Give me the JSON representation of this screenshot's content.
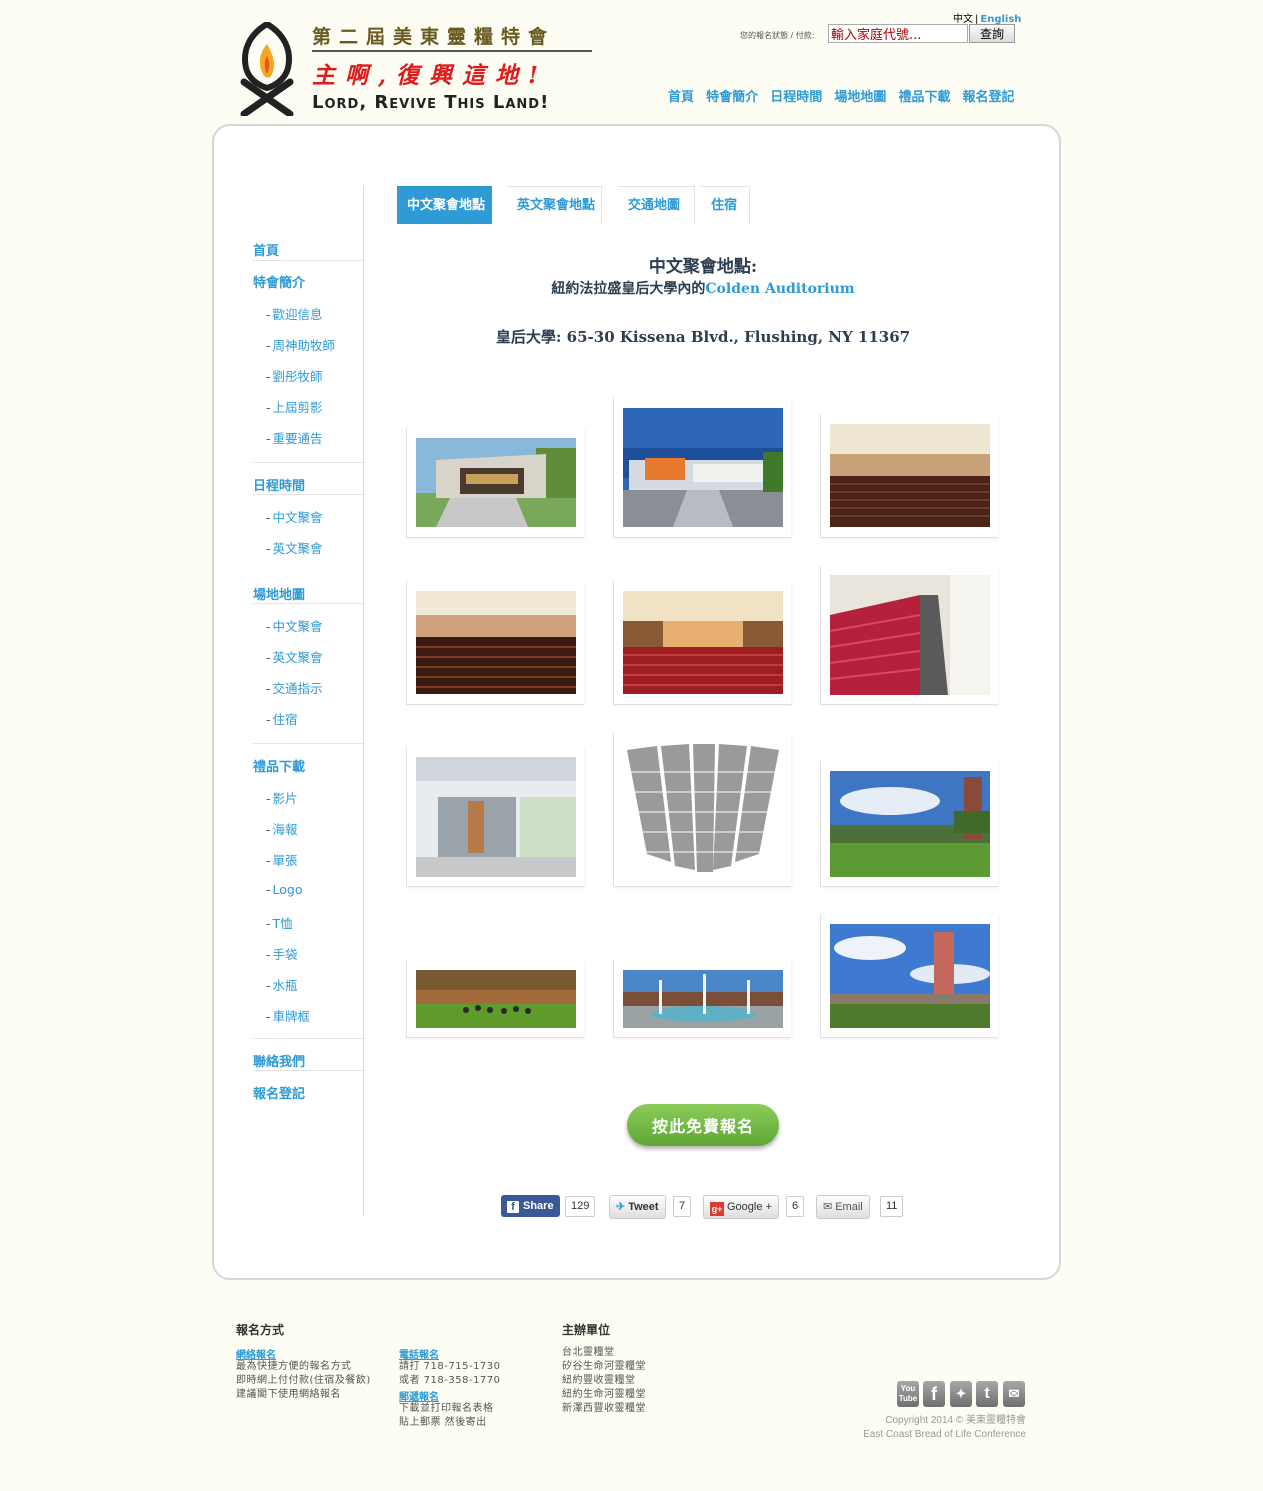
{
  "header": {
    "title_cn": "第二屆美東靈糧特會",
    "motto_cn": "主啊,復興這地!",
    "motto_en": "Lord, Revive This Land!",
    "lang_current": "中文",
    "lang_sep": "|",
    "lang_other": "English",
    "search_label": "您的報名狀態 / 付款:",
    "search_placeholder": "輸入家庭代號...",
    "search_button": "查詢",
    "nav": [
      "首頁",
      "特會簡介",
      "日程時間",
      "場地地圖",
      "禮品下載",
      "報名登記"
    ]
  },
  "sidebar": {
    "sections": [
      {
        "label": "首頁"
      },
      {
        "label": "特會簡介",
        "items": [
          "歡迎信息",
          "周神助牧師",
          "劉彤牧師",
          "上屆剪影",
          "重要通告"
        ]
      },
      {
        "label": "日程時間",
        "items": [
          "中文聚會",
          "英文聚會"
        ]
      },
      {
        "label": "場地地圖",
        "items": [
          "中文聚會",
          "英文聚會",
          "交通指示",
          "住宿"
        ]
      },
      {
        "label": "禮品下載",
        "items": [
          "影片",
          "海報",
          "單張",
          "Logo",
          "T恤",
          "手袋",
          "水瓶",
          "車牌框"
        ]
      },
      {
        "label": "聯絡我們"
      },
      {
        "label": "報名登記"
      }
    ],
    "dash": "-"
  },
  "tabs": [
    "中文聚會地點",
    "英文聚會地點",
    "交通地圖",
    "住宿"
  ],
  "venue": {
    "title": "中文聚會地點:",
    "subtitle_cn": "紐約法拉盛皇后大學內的",
    "subtitle_en": "Colden Auditorium",
    "address": "皇后大學: 65-30 Kissena Blvd., Flushing, NY 11367"
  },
  "gallery": [
    "auditorium-exterior-rendering",
    "auditorium-entrance-dusk",
    "auditorium-hall-seats",
    "auditorium-hall-wide",
    "auditorium-stage-view",
    "auditorium-side-seats",
    "auditorium-lobby",
    "seating-chart",
    "campus-clock-tower",
    "campus-lawn",
    "campus-fountain",
    "campus-tower-plaza"
  ],
  "cta_label": "按此免費報名",
  "share": {
    "facebook": {
      "label": "Share",
      "count": "129"
    },
    "twitter": {
      "label": "Tweet",
      "count": "7"
    },
    "google": {
      "label": "Google +",
      "count": "6"
    },
    "email": {
      "label": "Email",
      "count": "11"
    }
  },
  "footer": {
    "col1_title": "報名方式",
    "online_title": "網絡報名",
    "online_lines": [
      "最為快捷方便的報名方式",
      "即時網上付付款(住宿及餐飲)",
      "建議閣下使用網絡報名"
    ],
    "phone_title": "電話報名",
    "phone_lines": [
      "請打 718-715-1730",
      "或者 718-358-1770"
    ],
    "mail_title": "郵遞報名",
    "mail_lines": [
      "下載並打印報名表格",
      "貼上郵票 然後寄出"
    ],
    "organizers_title": "主辦單位",
    "organizers": [
      "台北靈糧堂",
      "矽谷生命河靈糧堂",
      "紐約豐收靈糧堂",
      "紐約生命河靈糧堂",
      "新澤西豐收靈糧堂"
    ],
    "social": [
      "youtube-icon",
      "facebook-icon",
      "myspace-icon",
      "twitter-icon",
      "email-icon"
    ],
    "copyright_1": "Copyright 2014 © 美東靈糧特會",
    "copyright_2": "East Coast Bread of Life Conference"
  },
  "colors": {
    "accent": "#2e9bd6",
    "cta_green": "#6cb23f",
    "panel_bg": "#ffffff",
    "page_bg": "#fdfdf4"
  }
}
